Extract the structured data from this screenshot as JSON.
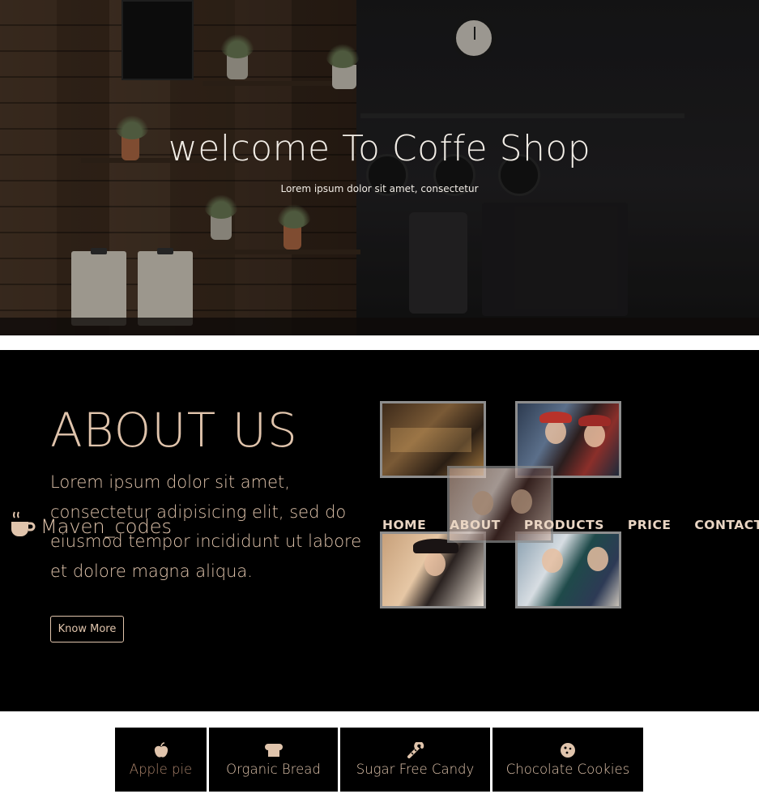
{
  "hero": {
    "title": "welcome To Coffe Shop",
    "subtitle": "Lorem ipsum dolor sit amet, consectetur"
  },
  "about": {
    "title": "ABOUT US",
    "text": "Lorem ipsum dolor sit amet, consectetur adipisicing elit, sed do eiusmod tempor incididunt ut labore et dolore magna aliqua.",
    "button_label": "Know More"
  },
  "brand": {
    "name": "Maven_codes",
    "icon": "coffee-cup-icon"
  },
  "nav": {
    "items": [
      {
        "label": "HOME"
      },
      {
        "label": "ABOUT"
      },
      {
        "label": "PRODUCTS"
      },
      {
        "label": "PRICE"
      },
      {
        "label": "CONTACT"
      }
    ]
  },
  "menu": {
    "tabs": [
      {
        "label": "Apple pie",
        "icon": "apple-icon",
        "active": true
      },
      {
        "label": "Organic Bread",
        "icon": "bread-icon",
        "active": false
      },
      {
        "label": "Sugar Free Candy",
        "icon": "candy-cane-icon",
        "active": false
      },
      {
        "label": "Chocolate Cookies",
        "icon": "cookie-icon",
        "active": false
      }
    ]
  },
  "colors": {
    "accent": "#e0c4ac",
    "active_tab_text": "#a8826a",
    "section_bg": "#000000"
  }
}
